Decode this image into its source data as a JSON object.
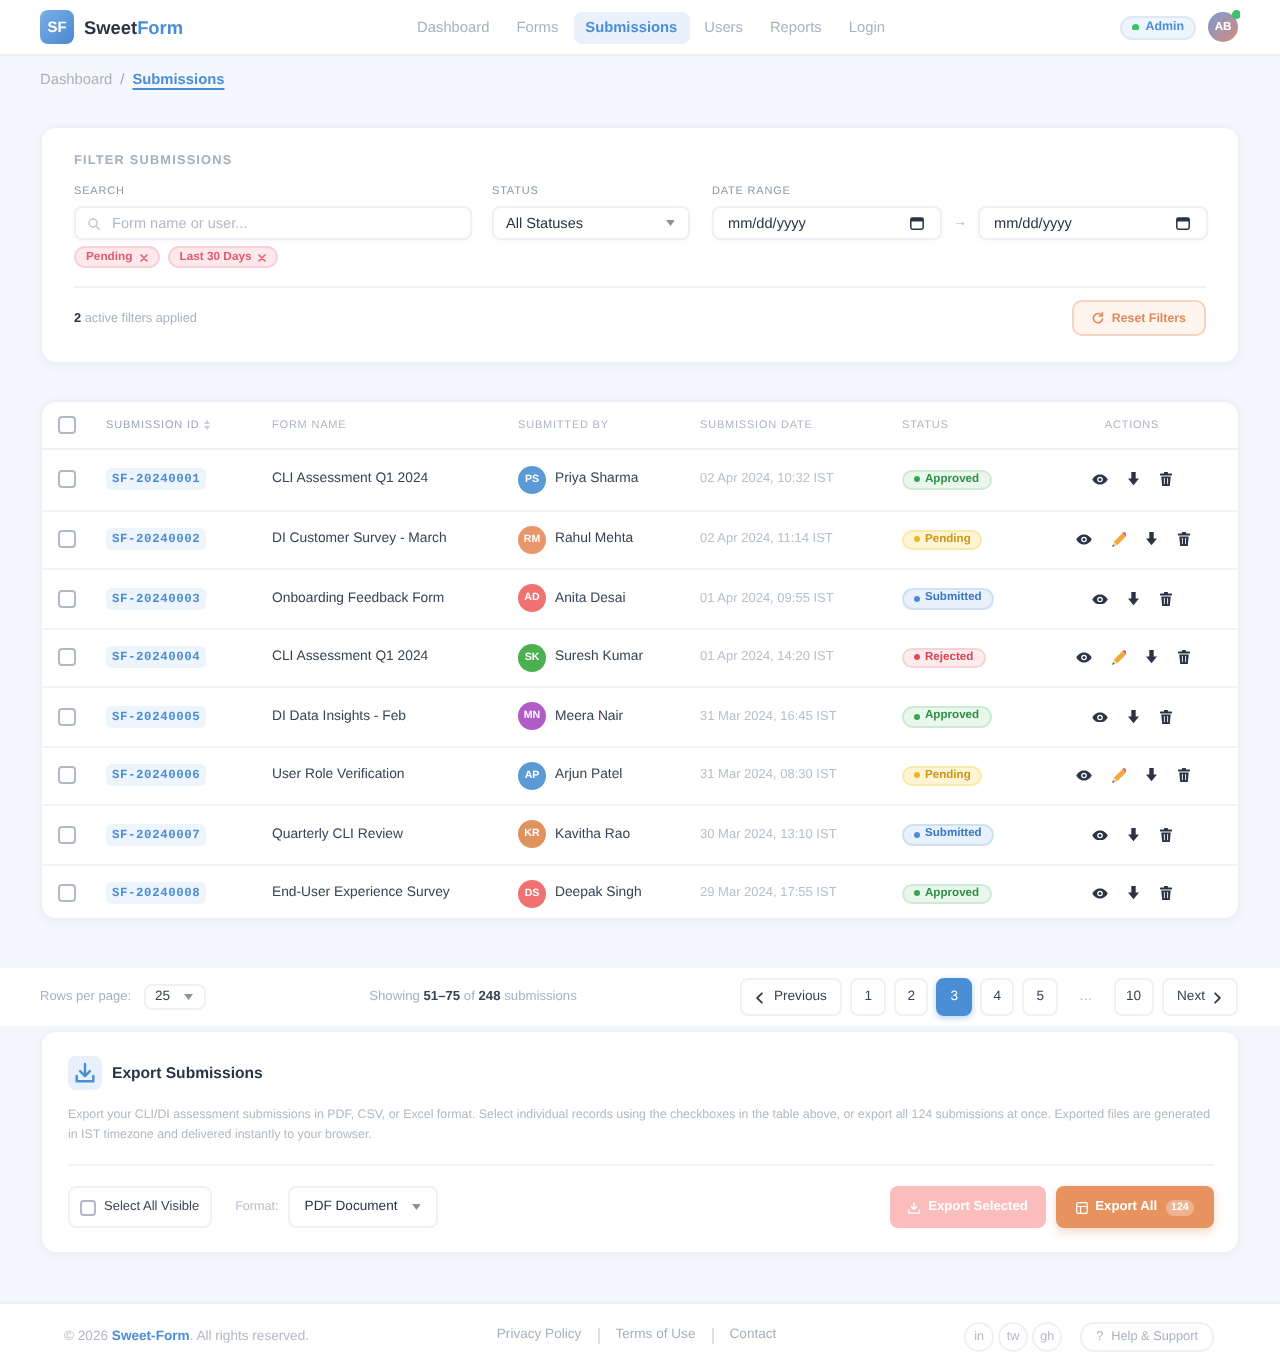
{
  "header": {
    "logo": "SF",
    "brand": [
      {
        "text": "Sweet",
        "accent": false
      },
      {
        "text": "Form",
        "accent": true
      }
    ],
    "nav": [
      {
        "label": "Dashboard",
        "selected": false
      },
      {
        "label": "Forms",
        "selected": false
      },
      {
        "label": "Submissions",
        "selected": true
      },
      {
        "label": "Users",
        "selected": false
      },
      {
        "label": "Reports",
        "selected": false
      },
      {
        "label": "Login",
        "selected": false
      }
    ],
    "role_badge": "Admin",
    "avatar": {
      "initials": "AB",
      "online": true
    }
  },
  "breadcrumb": {
    "separator": "/",
    "items": [
      {
        "label": "Dashboard",
        "current": false
      },
      {
        "label": "Submissions",
        "current": true
      }
    ]
  },
  "filters": {
    "title": "FILTER SUBMISSIONS",
    "search": {
      "label": "SEARCH",
      "placeholder": "Form name or user..."
    },
    "status": {
      "label": "STATUS",
      "value": "All Statuses"
    },
    "date_range": {
      "label": "DATE RANGE",
      "from": {
        "placeholder": "mm/dd/yyyy"
      },
      "separator": "→",
      "to": {
        "placeholder": "mm/dd/yyyy"
      }
    },
    "chips": [
      {
        "label": "Pending"
      },
      {
        "label": "Last 30 Days"
      }
    ],
    "summary": "**2** active filters applied",
    "reset_button": "Reset Filters"
  },
  "table": {
    "select_all": {
      "checked": false
    },
    "columns": [
      {
        "label": "SUBMISSION ID",
        "sorted": true
      },
      {
        "label": "FORM NAME",
        "sorted": false
      },
      {
        "label": "SUBMITTED BY",
        "sorted": false
      },
      {
        "label": "SUBMISSION DATE",
        "sorted": false
      },
      {
        "label": "STATUS",
        "sorted": false
      },
      {
        "label": "ACTIONS",
        "sorted": false
      }
    ],
    "rows": [
      {
        "checked": false,
        "id": "SF-20240001",
        "form": "CLI Assessment Q1 2024",
        "submitter": {
          "initials": "PS",
          "name": "Priya Sharma",
          "color": "#5b9bd5"
        },
        "date": "02 Apr 2024, 10:32 IST",
        "status": {
          "kind": "approved",
          "label": "Approved"
        },
        "actions": [
          {
            "kind": "view"
          },
          {
            "kind": "download"
          },
          {
            "kind": "delete"
          }
        ]
      },
      {
        "checked": false,
        "id": "SF-20240002",
        "form": "DI Customer Survey - March",
        "submitter": {
          "initials": "RM",
          "name": "Rahul Mehta",
          "color": "#e8966a"
        },
        "date": "02 Apr 2024, 11:14 IST",
        "status": {
          "kind": "pending",
          "label": "Pending"
        },
        "actions": [
          {
            "kind": "view"
          },
          {
            "kind": "edit"
          },
          {
            "kind": "download"
          },
          {
            "kind": "delete"
          }
        ]
      },
      {
        "checked": false,
        "id": "SF-20240003",
        "form": "Onboarding Feedback Form",
        "submitter": {
          "initials": "AD",
          "name": "Anita Desai",
          "color": "#f07272"
        },
        "date": "01 Apr 2024, 09:55 IST",
        "status": {
          "kind": "submitted",
          "label": "Submitted"
        },
        "actions": [
          {
            "kind": "view"
          },
          {
            "kind": "download"
          },
          {
            "kind": "delete"
          }
        ]
      },
      {
        "checked": false,
        "id": "SF-20240004",
        "form": "CLI Assessment Q1 2024",
        "submitter": {
          "initials": "SK",
          "name": "Suresh Kumar",
          "color": "#4caf50"
        },
        "date": "01 Apr 2024, 14:20 IST",
        "status": {
          "kind": "rejected",
          "label": "Rejected"
        },
        "actions": [
          {
            "kind": "view"
          },
          {
            "kind": "edit"
          },
          {
            "kind": "download"
          },
          {
            "kind": "delete"
          }
        ]
      },
      {
        "checked": false,
        "id": "SF-20240005",
        "form": "DI Data Insights - Feb",
        "submitter": {
          "initials": "MN",
          "name": "Meera Nair",
          "color": "#b05cc7"
        },
        "date": "31 Mar 2024, 16:45 IST",
        "status": {
          "kind": "approved",
          "label": "Approved"
        },
        "actions": [
          {
            "kind": "view"
          },
          {
            "kind": "download"
          },
          {
            "kind": "delete"
          }
        ]
      },
      {
        "checked": false,
        "id": "SF-20240006",
        "form": "User Role Verification",
        "submitter": {
          "initials": "AP",
          "name": "Arjun Patel",
          "color": "#5b9bd5"
        },
        "date": "31 Mar 2024, 08:30 IST",
        "status": {
          "kind": "pending",
          "label": "Pending"
        },
        "actions": [
          {
            "kind": "view"
          },
          {
            "kind": "edit"
          },
          {
            "kind": "download"
          },
          {
            "kind": "delete"
          }
        ]
      },
      {
        "checked": false,
        "id": "SF-20240007",
        "form": "Quarterly CLI Review",
        "submitter": {
          "initials": "KR",
          "name": "Kavitha Rao",
          "color": "#e0935e"
        },
        "date": "30 Mar 2024, 13:10 IST",
        "status": {
          "kind": "submitted",
          "label": "Submitted"
        },
        "actions": [
          {
            "kind": "view"
          },
          {
            "kind": "download"
          },
          {
            "kind": "delete"
          }
        ]
      },
      {
        "checked": false,
        "id": "SF-20240008",
        "form": "End-User Experience Survey",
        "submitter": {
          "initials": "DS",
          "name": "Deepak Singh",
          "color": "#f07272"
        },
        "date": "29 Mar 2024, 17:55 IST",
        "status": {
          "kind": "approved",
          "label": "Approved"
        },
        "actions": [
          {
            "kind": "view"
          },
          {
            "kind": "download"
          },
          {
            "kind": "delete"
          }
        ]
      }
    ]
  },
  "pagination": {
    "rows_per_page": {
      "label": "Rows per page:",
      "value": "25"
    },
    "summary": "Showing **51–75** of **248** submissions",
    "previous": "Previous",
    "pages": [
      {
        "kind": "page",
        "label": "1",
        "selected": false
      },
      {
        "kind": "page",
        "label": "2",
        "selected": false
      },
      {
        "kind": "page",
        "label": "3",
        "selected": true
      },
      {
        "kind": "page",
        "label": "4",
        "selected": false
      },
      {
        "kind": "page",
        "label": "5",
        "selected": false
      },
      {
        "kind": "gap",
        "label": "…"
      },
      {
        "kind": "page",
        "label": "10",
        "selected": false
      }
    ],
    "next": "Next"
  },
  "export": {
    "title": "Export Submissions",
    "description": "Export your CLI/DI assessment submissions in PDF, CSV, or Excel format. Select individual records using the checkboxes in the table above, or export all 124 submissions at once. Exported files are generated in IST timezone and delivered instantly to your browser.",
    "select_all": {
      "label": "Select All Visible",
      "checked": false
    },
    "format": {
      "label": "Format:",
      "value": "PDF Document"
    },
    "export_selected": {
      "label": "Export Selected",
      "disabled": true
    },
    "export_all": {
      "label": "Export All",
      "count": "124"
    }
  },
  "footer": {
    "copyright": "© 2026 **Sweet-Form**. All rights reserved.",
    "links": [
      "Privacy Policy",
      "Terms of Use",
      "Contact"
    ],
    "social": [
      "in",
      "tw",
      "gh"
    ],
    "help": {
      "icon": "?",
      "label": "Help & Support"
    }
  }
}
